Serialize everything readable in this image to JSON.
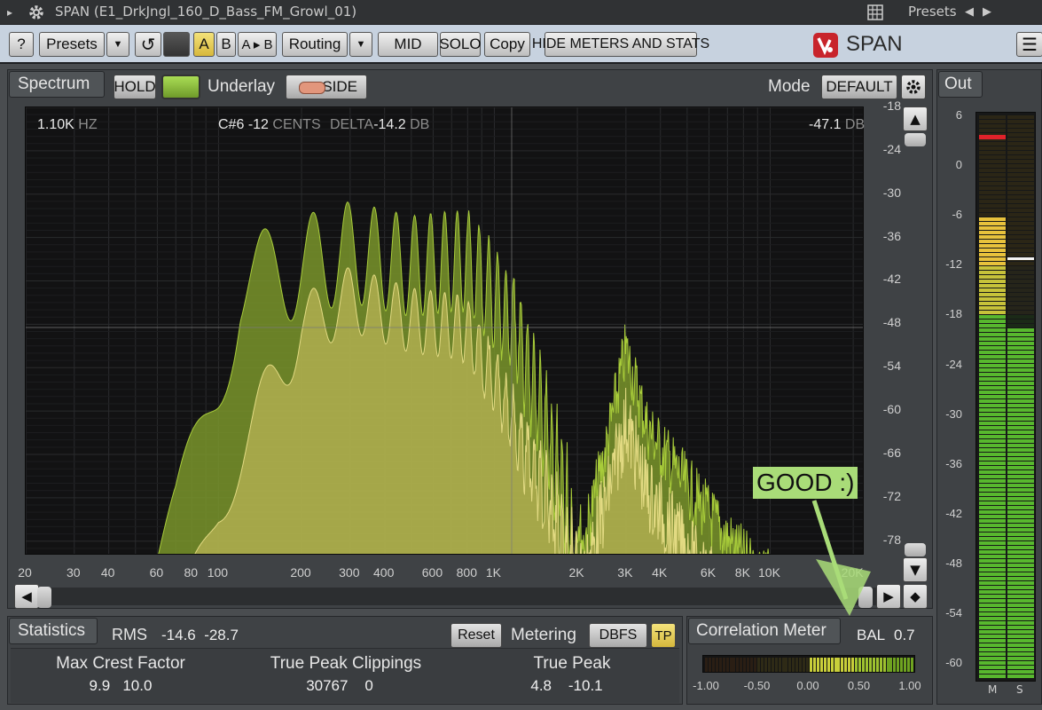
{
  "titlebar": {
    "expand_glyph": "▸",
    "title": "SPAN (E1_DrkJngl_160_D_Bass_FM_Growl_01)",
    "presets_label": "Presets",
    "prev_glyph": "◀",
    "next_glyph": "▶"
  },
  "toolbar": {
    "help": "?",
    "presets": "Presets",
    "dropdown": "▼",
    "undo": "↺",
    "a": "A",
    "b": "B",
    "ab": "A ▸ B",
    "routing": "Routing",
    "mid": "MID",
    "solo": "SOLO",
    "copy": "Copy",
    "hide_meters": "HIDE METERS AND STATS",
    "brand": "SPAN",
    "menu_glyph": "☰"
  },
  "spectrum": {
    "label": "Spectrum",
    "hold": "HOLD",
    "underlay_label": "Underlay",
    "side": "SIDE",
    "mode_label": "Mode",
    "mode_value": "DEFAULT",
    "readout": {
      "freq": "1.10K",
      "freq_unit": "HZ",
      "note": "C#6",
      "cents": "-12",
      "cents_unit": "CENTS",
      "delta_label": "DELTA",
      "delta": "-14.2",
      "delta_unit": "DB",
      "level": "-47.1",
      "level_unit": "DB"
    },
    "y_ticks": [
      "-18",
      "-24",
      "-30",
      "-36",
      "-42",
      "-48",
      "-54",
      "-60",
      "-66",
      "-72",
      "-78"
    ],
    "x_ticks": [
      "20",
      "30",
      "40",
      "60",
      "80",
      "100",
      "200",
      "300",
      "400",
      "600",
      "800",
      "1K",
      "2K",
      "3K",
      "4K",
      "6K",
      "8K",
      "10K",
      "20K"
    ],
    "colors": {
      "main": "#8aa62f",
      "underlay": "#b9b455",
      "hold": "#8ac33a",
      "side": "#e2967c"
    }
  },
  "annotation": {
    "text": "GOOD :)",
    "color": "#a9dc78"
  },
  "stats": {
    "label": "Statistics",
    "rms_label": "RMS",
    "rms_values": "-14.6  -28.7",
    "reset": "Reset",
    "metering_label": "Metering",
    "metering_value": "DBFS",
    "tp": "TP",
    "max_crest_label": "Max Crest Factor",
    "max_crest_values": "9.9   10.0",
    "tp_clip_label": "True Peak Clippings",
    "tp_clip_values": "30767    0",
    "true_peak_label": "True Peak",
    "true_peak_values": "4.8    -10.1"
  },
  "correlation": {
    "label": "Correlation Meter",
    "bal_label": "BAL",
    "bal_value": "0.7",
    "ticks": [
      "-1.00",
      "-0.50",
      "0.00",
      "0.50",
      "1.00"
    ]
  },
  "out": {
    "label": "Out",
    "ticks": [
      "6",
      "0",
      "-6",
      "-12",
      "-18",
      "-24",
      "-30",
      "-36",
      "-42",
      "-48",
      "-54",
      "-60"
    ],
    "m_label": "M",
    "s_label": "S"
  }
}
